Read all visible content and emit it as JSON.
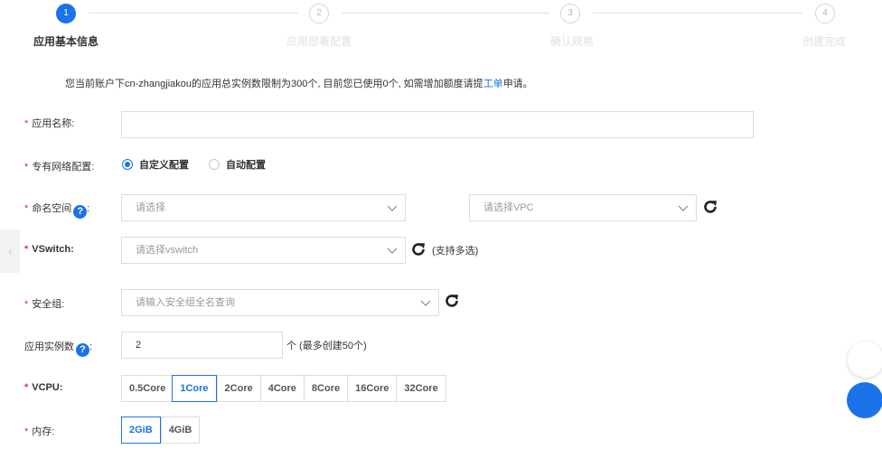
{
  "stepper": {
    "steps": [
      {
        "num": "1",
        "label": "应用基本信息",
        "state": "active"
      },
      {
        "num": "2",
        "label": "应用部署配置",
        "state": "todo"
      },
      {
        "num": "3",
        "label": "确认规格",
        "state": "todo"
      },
      {
        "num": "4",
        "label": "创建完成",
        "state": "todo"
      }
    ]
  },
  "notice": {
    "text": "您当前账户下cn-zhangjiakou的应用总实例数限制为300个, 目前您已使用0个, 如需增加额度请提",
    "link": "工单",
    "suffix": "申请。"
  },
  "form": {
    "app_name": {
      "label": "应用名称:",
      "value": ""
    },
    "vpc_config": {
      "label": "专有网络配置:",
      "options": [
        {
          "label": "自定义配置",
          "selected": true
        },
        {
          "label": "自动配置",
          "selected": false
        }
      ]
    },
    "namespace": {
      "label": "命名空间",
      "colon": ":",
      "placeholder": "请选择",
      "vpc_placeholder": "请选择VPC"
    },
    "vswitch": {
      "label": "VSwitch:",
      "placeholder": "请选择vswitch",
      "hint": "(支持多选)"
    },
    "security_group": {
      "label": "安全组:",
      "placeholder": "请输入安全组全名查询"
    },
    "instances": {
      "label": "应用实例数",
      "colon": ":",
      "value": "2",
      "hint": "个 (最多创建50个)"
    },
    "vcpu": {
      "label": "VCPU:",
      "options": [
        "0.5Core",
        "1Core",
        "2Core",
        "4Core",
        "8Core",
        "16Core",
        "32Core"
      ],
      "selected": "1Core"
    },
    "memory": {
      "label": "内存:",
      "options": [
        "2GiB",
        "4GiB"
      ],
      "selected": "2GiB"
    }
  },
  "colors": {
    "accent": "#1a73e8",
    "required": "#e0312b",
    "border": "#dcdcdc"
  },
  "icons": {
    "help": "question-circle-icon",
    "refresh": "refresh-icon",
    "chevron": "chevron-down-icon"
  }
}
